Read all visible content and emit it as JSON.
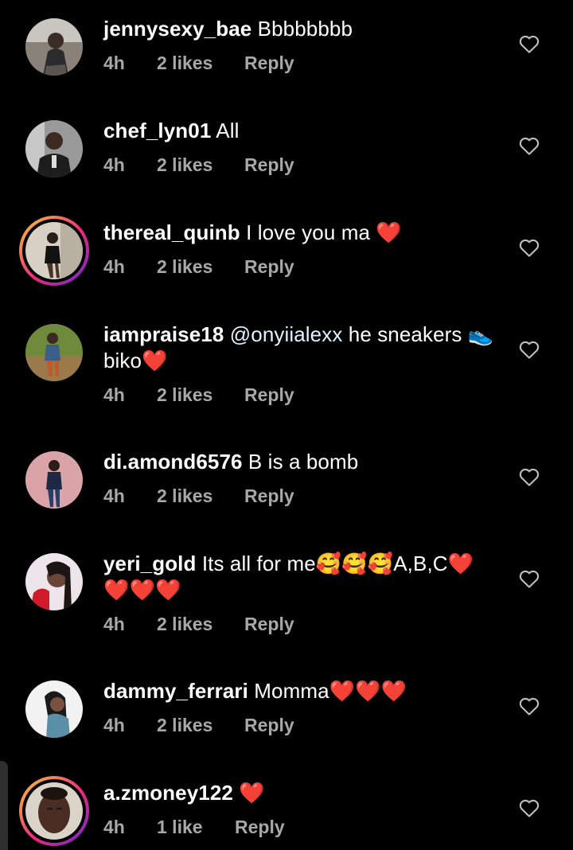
{
  "comments": [
    {
      "username": "jennysexy_bae",
      "text": "Bbbbbbbb",
      "time": "4h",
      "likes": "2 likes",
      "reply": "Reply",
      "story_ring": false,
      "avatar_icon": "user-avatar"
    },
    {
      "username": "chef_lyn01",
      "text": "All",
      "time": "4h",
      "likes": "2 likes",
      "reply": "Reply",
      "story_ring": false,
      "avatar_icon": "user-avatar"
    },
    {
      "username": "thereal_quinb",
      "text": "I love you ma ❤️",
      "time": "4h",
      "likes": "2 likes",
      "reply": "Reply",
      "story_ring": true,
      "avatar_icon": "user-avatar"
    },
    {
      "username": "iampraise18",
      "mention": "@onyiialexx",
      "text": "he sneakers 👟 biko❤️",
      "time": "4h",
      "likes": "2 likes",
      "reply": "Reply",
      "story_ring": false,
      "avatar_icon": "user-avatar"
    },
    {
      "username": "di.amond6576",
      "text": "B is a bomb",
      "time": "4h",
      "likes": "2 likes",
      "reply": "Reply",
      "story_ring": false,
      "avatar_icon": "user-avatar"
    },
    {
      "username": "yeri_gold",
      "text": "Its all for me🥰🥰🥰A,B,C❤️ ❤️❤️❤️",
      "time": "4h",
      "likes": "2 likes",
      "reply": "Reply",
      "story_ring": false,
      "avatar_icon": "user-avatar"
    },
    {
      "username": "dammy_ferrari",
      "text": "Momma❤️❤️❤️",
      "time": "4h",
      "likes": "2 likes",
      "reply": "Reply",
      "story_ring": false,
      "avatar_icon": "user-avatar"
    },
    {
      "username": "a.zmoney122",
      "text": "❤️",
      "time": "4h",
      "likes": "1 like",
      "reply": "Reply",
      "story_ring": true,
      "avatar_icon": "user-avatar"
    }
  ],
  "colors": {
    "background": "#000000",
    "meta_text": "#a8a8a8",
    "heart": "#ff1f2d"
  }
}
